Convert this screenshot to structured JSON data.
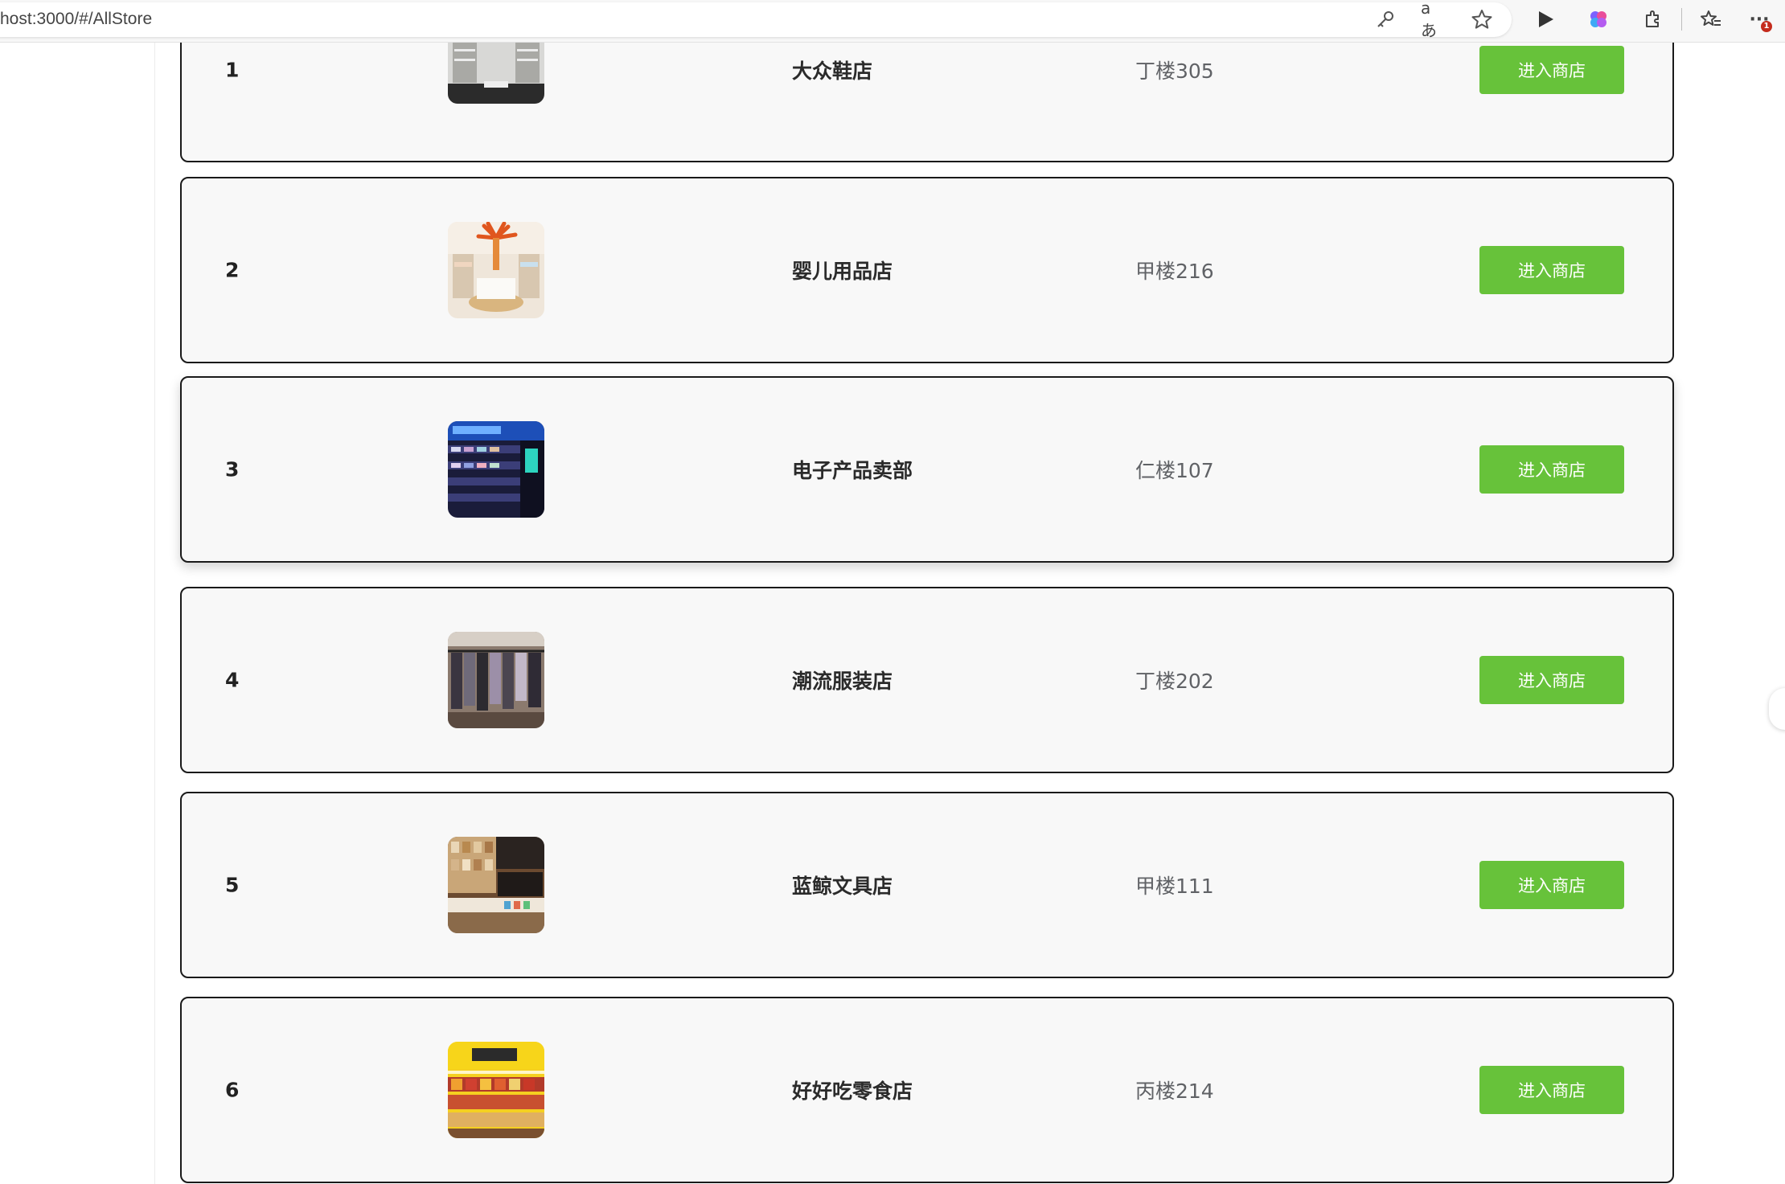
{
  "browser": {
    "url": "host:3000/#/AllStore",
    "icons": [
      "key-icon",
      "translate-icon",
      "star-icon",
      "play-icon",
      "brain-icon",
      "extensions-icon",
      "favorites-icon",
      "more-icon"
    ],
    "translate_label": "aあ",
    "more_label": "···",
    "badge_count": "1"
  },
  "stores": [
    {
      "index": "1",
      "name": "大众鞋店",
      "location": "丁楼305",
      "button": "进入商店",
      "image": "shoe-store-image"
    },
    {
      "index": "2",
      "name": "婴儿用品店",
      "location": "甲楼216",
      "button": "进入商店",
      "image": "baby-store-image"
    },
    {
      "index": "3",
      "name": "电子产品卖部",
      "location": "仁楼107",
      "button": "进入商店",
      "image": "electronics-store-image"
    },
    {
      "index": "4",
      "name": "潮流服装店",
      "location": "丁楼202",
      "button": "进入商店",
      "image": "clothing-store-image"
    },
    {
      "index": "5",
      "name": "蓝鲸文具店",
      "location": "甲楼111",
      "button": "进入商店",
      "image": "stationery-store-image"
    },
    {
      "index": "6",
      "name": "好好吃零食店",
      "location": "丙楼214",
      "button": "进入商店",
      "image": "snack-store-image"
    }
  ],
  "colors": {
    "button_bg": "#67c23a",
    "row_bg": "#f8f8f8",
    "row_border": "#1a1a1a"
  }
}
